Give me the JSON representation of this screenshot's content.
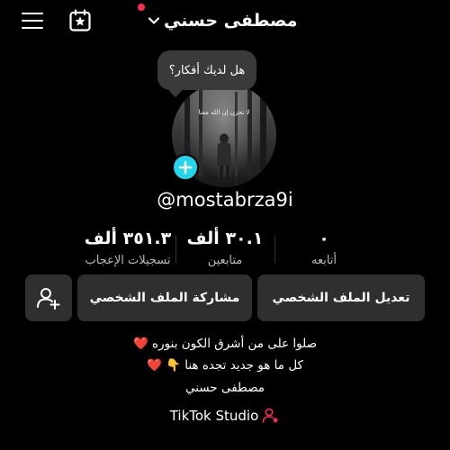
{
  "header": {
    "username": "مصطفى حسني",
    "icons": {
      "menu": "menu-icon",
      "calendar": "calendar-star-icon",
      "dropdown": "chevron-down-icon"
    },
    "notification_color": "#fe2c55"
  },
  "profile": {
    "thought_bubble": "هل لديك أفكار؟",
    "avatar_caption": "لا تحزن إن الله معنا",
    "handle": "@mostabrza9i",
    "add_color": "#20d5ec"
  },
  "stats": [
    {
      "value": "٣٥١.٣ ألف",
      "label": "تسجيلات الإعجاب"
    },
    {
      "value": "٣٠.١ ألف",
      "label": "متابعين"
    },
    {
      "value": "٠",
      "label": "أتابعه"
    }
  ],
  "actions": {
    "edit_profile": "تعديل الملف الشخصي",
    "share_profile": "مشاركة الملف الشخصي"
  },
  "bio": {
    "line1": "صلوا على من أشرق الكون بنوره ❤️",
    "line2": "كل ما هو جديد تجده هنا 👇 ❤️",
    "line3": "مصطفى حسني",
    "studio": "TikTok Studio"
  }
}
